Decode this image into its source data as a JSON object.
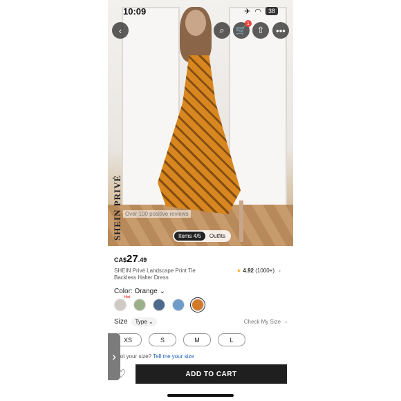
{
  "status": {
    "time": "10:09",
    "battery": "38"
  },
  "photo": {
    "brand": "SHEIN PRIVÉ",
    "reviews_text": "Over 100 positive reviews",
    "pills": [
      "Items 4/5",
      "Outfits"
    ]
  },
  "product": {
    "currency": "CA$",
    "price_main": "27",
    "price_cents": ".49",
    "title": "SHEIN Privé Landscape Print Tie Backless Halter Dress",
    "rating": "4.92",
    "rating_count": "(1000+)",
    "color_label": "Color: Orange",
    "swatches": [
      {
        "color": "#cfcac4",
        "hot": true
      },
      {
        "color": "#9bb08a"
      },
      {
        "color": "#4d6a8e"
      },
      {
        "color": "#6f9bc8"
      },
      {
        "color": "#d27a2a",
        "selected": true
      }
    ],
    "hot_label": "Hot",
    "size_label": "Size",
    "type_label": "Type",
    "check_size": "Check My Size",
    "sizes": [
      "XS",
      "S",
      "M",
      "L"
    ],
    "not_size_prefix": "Not your size?",
    "tell_me": "Tell me your size"
  },
  "actions": {
    "add_to_cart": "ADD TO CART",
    "cart_count": "1"
  }
}
